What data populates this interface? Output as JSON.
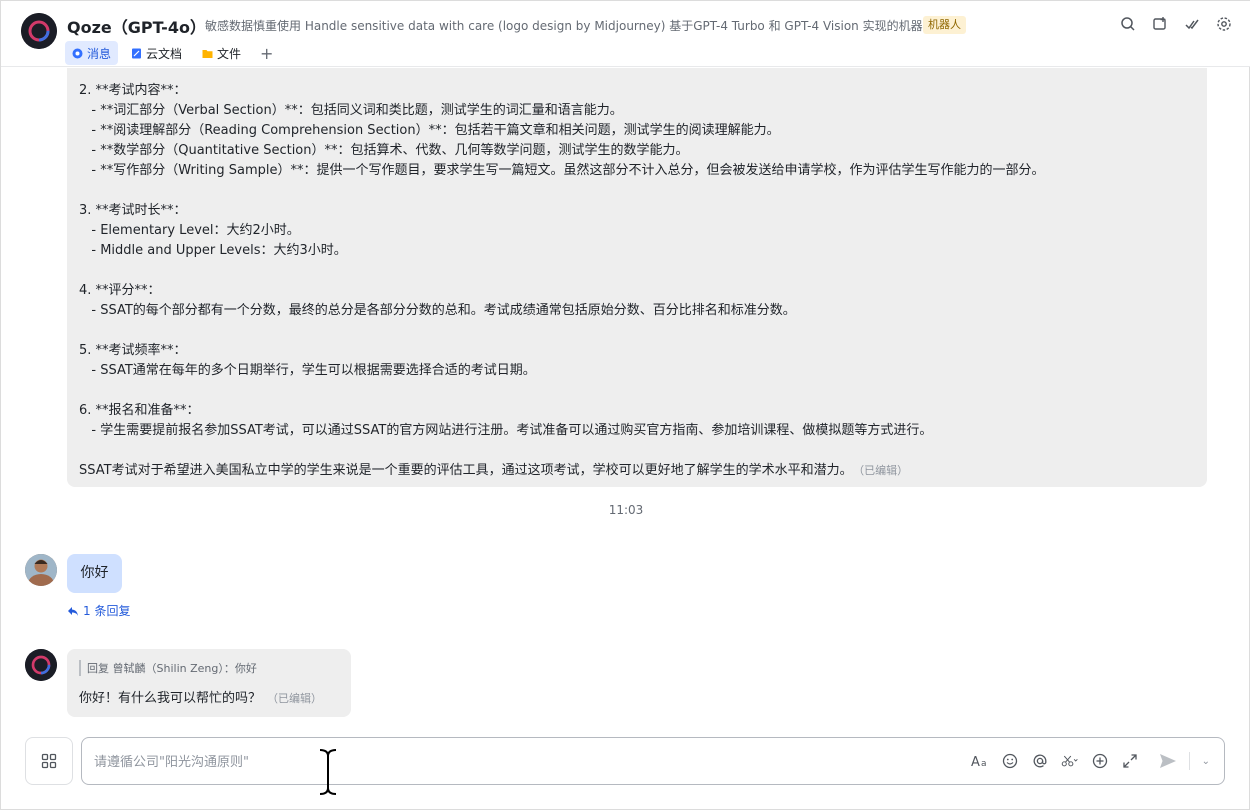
{
  "header": {
    "title": "Qoze（GPT-4o）",
    "description": "敏感数据慎重使用 Handle sensitive data with care (logo design by Midjourney) 基于GPT-4 Turbo 和 GPT-4 Vision 实现的机器人",
    "badge": "机器人",
    "tabs": [
      {
        "label": "消息",
        "icon": "message-icon",
        "active": true
      },
      {
        "label": "云文档",
        "icon": "doc-icon",
        "active": false
      },
      {
        "label": "文件",
        "icon": "folder-icon",
        "active": false
      }
    ],
    "add_tab": "+",
    "tools": [
      "search-icon",
      "new-window-icon",
      "checked-icon",
      "settings-icon"
    ]
  },
  "messages": {
    "bot_long_reply_lines": [
      "2. **考试内容**：",
      "   - **词汇部分（Verbal Section）**：包括同义词和类比题，测试学生的词汇量和语言能力。",
      "   - **阅读理解部分（Reading Comprehension Section）**：包括若干篇文章和相关问题，测试学生的阅读理解能力。",
      "   - **数学部分（Quantitative Section）**：包括算术、代数、几何等数学问题，测试学生的数学能力。",
      "   - **写作部分（Writing Sample）**：提供一个写作题目，要求学生写一篇短文。虽然这部分不计入总分，但会被发送给申请学校，作为评估学生写作能力的一部分。",
      "",
      "3. **考试时长**：",
      "   - Elementary Level：大约2小时。",
      "   - Middle and Upper Levels：大约3小时。",
      "",
      "4. **评分**：",
      "   - SSAT的每个部分都有一个分数，最终的总分是各部分分数的总和。考试成绩通常包括原始分数、百分比排名和标准分数。",
      "",
      "5. **考试频率**：",
      "   - SSAT通常在每年的多个日期举行，学生可以根据需要选择合适的考试日期。",
      "",
      "6. **报名和准备**：",
      "   - 学生需要提前报名参加SSAT考试，可以通过SSAT的官方网站进行注册。考试准备可以通过购买官方指南、参加培训课程、做模拟题等方式进行。",
      "",
      "SSAT考试对于希望进入美国私立中学的学生来说是一个重要的评估工具，通过这项考试，学校可以更好地了解学生的学术水平和潜力。"
    ],
    "edited_label": "（已编辑）",
    "timestamp": "11:03",
    "user_message": "你好",
    "reply_count": "1 条回复",
    "reply_quote": "回复 曾轼麟（Shilin Zeng）：你好",
    "bot_reply": "你好！有什么我可以帮忙的吗？",
    "bot_reply_edited": "（已编辑）"
  },
  "composer": {
    "placeholder": "请遵循公司\"阳光沟通原则\"",
    "tools": [
      "font-format-icon",
      "emoji-icon",
      "mention-icon",
      "screenshot-icon",
      "add-icon",
      "expand-icon",
      "send-icon"
    ]
  }
}
